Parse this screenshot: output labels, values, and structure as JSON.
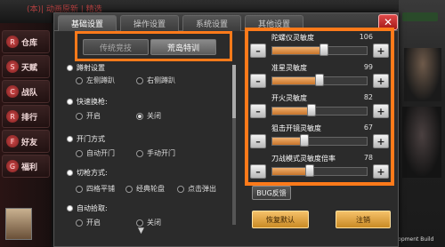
{
  "background": {
    "top_text": "(本)| 动画原新 | 精选",
    "nav_items": [
      {
        "label": "仓库",
        "icon": "R"
      },
      {
        "label": "天赋",
        "icon": "S"
      },
      {
        "label": "战队",
        "icon": "C"
      },
      {
        "label": "排行",
        "icon": "R"
      },
      {
        "label": "好友",
        "icon": "F"
      },
      {
        "label": "福利",
        "icon": "G"
      }
    ],
    "dev_text": "Development Build"
  },
  "dialog": {
    "tabs": [
      "基础设置",
      "操作设置",
      "系统设置",
      "其他设置"
    ],
    "active_tab": 0,
    "close_label": "✕",
    "mode": {
      "options": [
        "传统竞技",
        "荒岛特训"
      ],
      "selected": "荒岛特训"
    },
    "sections": [
      {
        "title": "蹲射设置",
        "options": [
          "左侧蹲趴",
          "右侧蹲趴"
        ],
        "selected": null
      },
      {
        "title": "快速换枪:",
        "options": [
          "开启",
          "关闭"
        ],
        "selected": "关闭"
      },
      {
        "title": "开门方式",
        "options": [
          "自动开门",
          "手动开门"
        ],
        "selected": null
      },
      {
        "title": "切枪方式:",
        "options": [
          "四格平铺",
          "经典轮盘",
          "点击弹出"
        ],
        "selected": null
      },
      {
        "title": "自动拾取:",
        "options": [
          "开启",
          "关闭"
        ],
        "selected": null
      }
    ],
    "sensitivity": [
      {
        "label": "陀螺仪灵敏度",
        "value": 106,
        "fill": 0.55
      },
      {
        "label": "准星灵敏度",
        "value": 99,
        "fill": 0.5
      },
      {
        "label": "开火灵敏度",
        "value": 82,
        "fill": 0.42
      },
      {
        "label": "狙击开镜灵敏度",
        "value": 67,
        "fill": 0.34
      },
      {
        "label": "刀战模式灵敏度倍率",
        "value": 78,
        "fill": 0.4
      }
    ],
    "minus_label": "–",
    "plus_label": "+",
    "buttons": {
      "bug": "BUG反馈",
      "reset": "恢复默认",
      "logout": "注销"
    }
  }
}
